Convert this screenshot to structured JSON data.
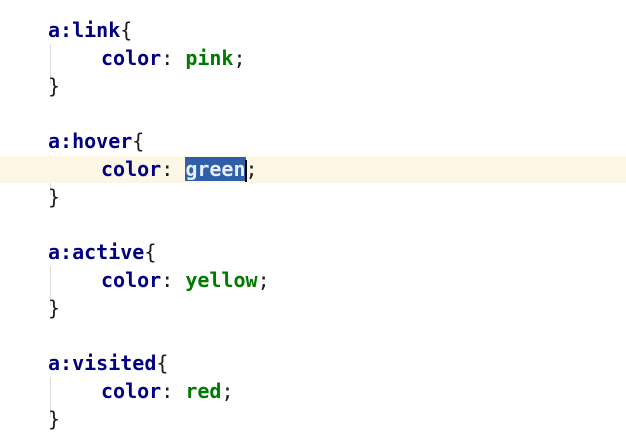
{
  "rules": [
    {
      "selector": "a:link",
      "open": "{",
      "property": "color",
      "colon": ":",
      "value": "pink",
      "semicolon": ";",
      "close": "}"
    },
    {
      "selector": "a:hover",
      "open": "{",
      "property": "color",
      "colon": ":",
      "value": "green",
      "semicolon": ";",
      "close": "}"
    },
    {
      "selector": "a:active",
      "open": "{",
      "property": "color",
      "colon": ":",
      "value": "yellow",
      "semicolon": ";",
      "close": "}"
    },
    {
      "selector": "a:visited",
      "open": "{",
      "property": "color",
      "colon": ":",
      "value": "red",
      "semicolon": ";",
      "close": "}"
    }
  ],
  "editor": {
    "current_line_rule": 1,
    "selected_value_rule": 1
  }
}
